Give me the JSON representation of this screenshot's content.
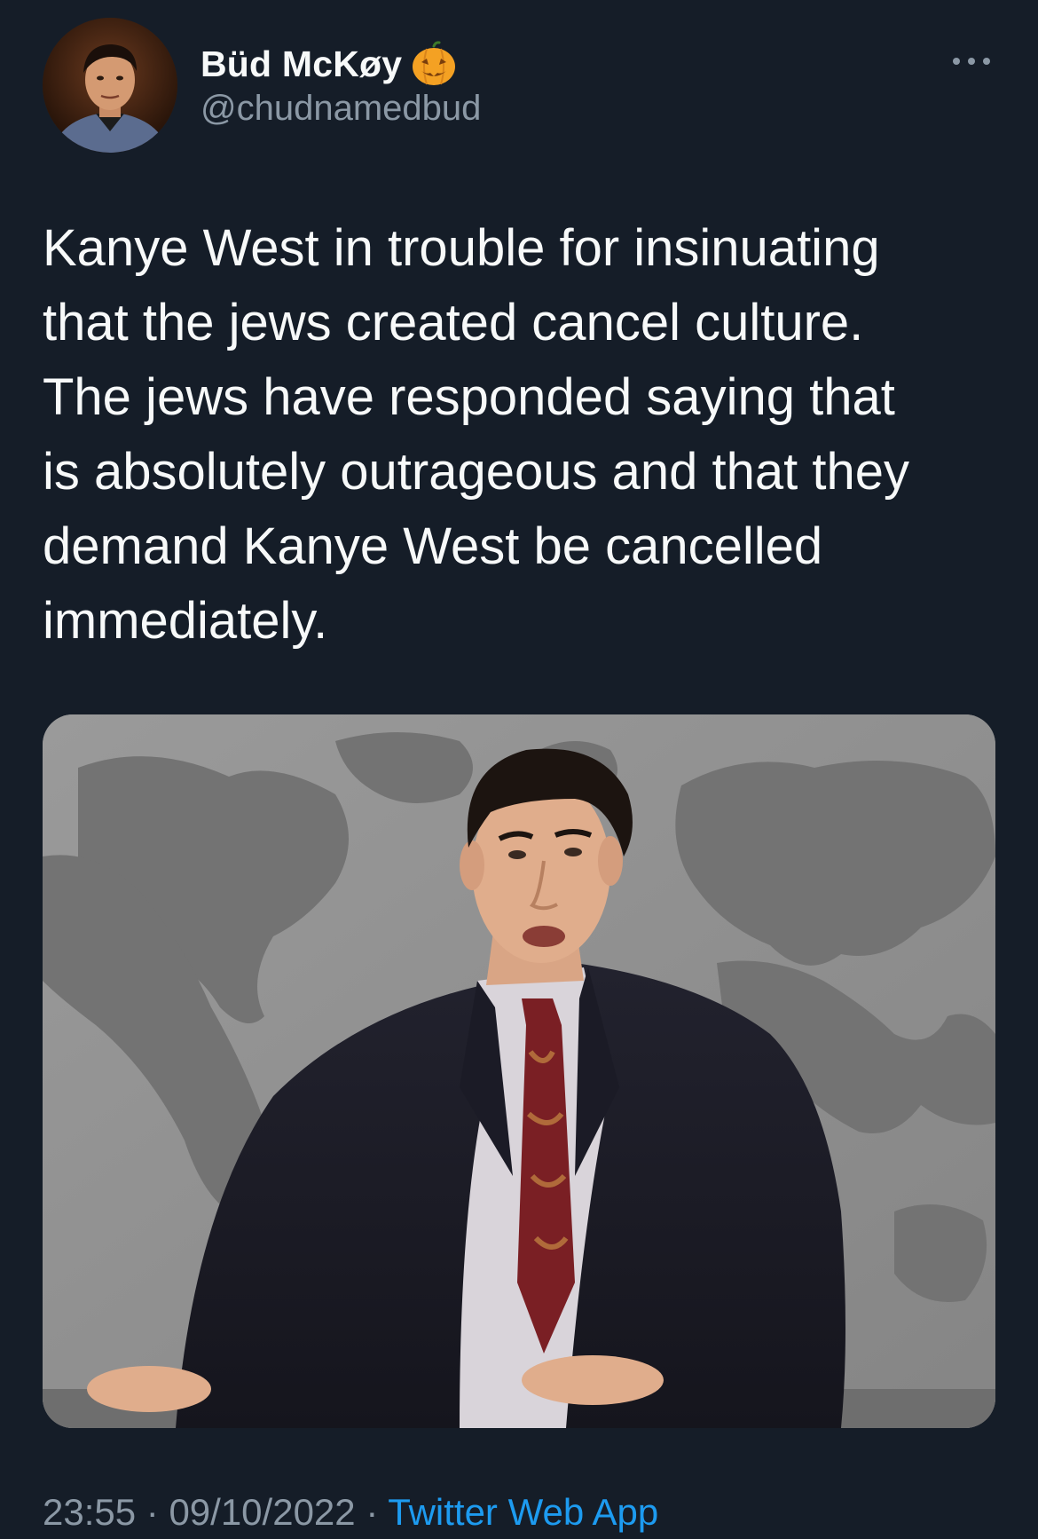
{
  "author": {
    "display_name": "Büd McKøy",
    "handle": "@chudnamedbud",
    "badge_icon": "pumpkin-icon"
  },
  "tweet": {
    "text": "Kanye West in trouble for insinuating\nthat the jews created cancel culture.\nThe jews have responded saying that\nis absolutely outrageous and that they\ndemand Kanye West be cancelled\nimmediately."
  },
  "meta": {
    "time": "23:55",
    "separator": " · ",
    "date": "09/10/2022",
    "source": "Twitter Web App"
  },
  "icons": {
    "more": "more-horizontal-icon"
  },
  "colors": {
    "background": "#151d28",
    "primary_text": "#f7f9f9",
    "secondary_text": "#8b98a5",
    "link": "#1d9bf0"
  }
}
